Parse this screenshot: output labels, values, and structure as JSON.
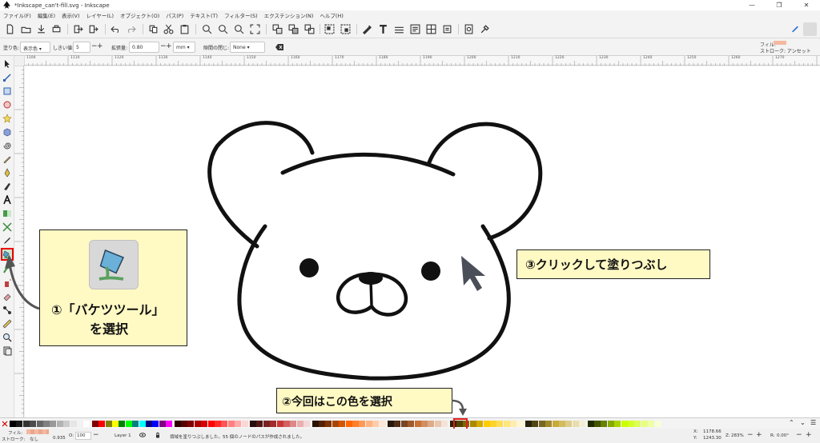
{
  "window": {
    "title": "*Inkscape_can't-fill.svg - Inkscape"
  },
  "menus": [
    "ファイル(F)",
    "編集(E)",
    "表示(V)",
    "レイヤー(L)",
    "オブジェクト(O)",
    "パス(P)",
    "テキスト(T)",
    "フィルター(S)",
    "エクステンション(N)",
    "ヘルプ(H)"
  ],
  "tool_controls": {
    "fill_by_label": "塗り色:",
    "fill_by_value": "表示色",
    "threshold_label": "しきい値:",
    "threshold_value": "5",
    "grow_label": "拡張量:",
    "grow_value": "0.80",
    "unit_value": "mm",
    "close_gaps_label": "隙間の閉じ:",
    "close_gaps_value": "None",
    "fill_indicator_label": "フィル:",
    "stroke_indicator_label": "ストローク: アンセット"
  },
  "ruler": {
    "labels": [
      "1100",
      "1110",
      "1120",
      "1130",
      "1140",
      "1150",
      "1160",
      "1170",
      "1180",
      "1190",
      "1200",
      "1210",
      "1220",
      "1230",
      "1240",
      "1250",
      "1260",
      "1270"
    ]
  },
  "annotations": {
    "step1_line1": "①「バケツツール」",
    "step1_line2": "を選択",
    "step2": "②今回はこの色を選択",
    "step3": "③クリックして塗りつぶし"
  },
  "status": {
    "fill_label": "フィル:",
    "stroke_label": "ストローク:",
    "stroke_value": "なし",
    "stroke_width": "0.935",
    "opacity_label": "O:",
    "opacity_value": "100",
    "layer": "Layer 1",
    "message": "領域を塗りつぶしました。55 個のノードのパスが作成されました。",
    "x_label": "X:",
    "x_value": "1178.66",
    "y_label": "Y:",
    "y_value": "1243.30",
    "zoom_label": "Z:",
    "zoom_value": "283%",
    "rotation_label": "R:",
    "rotation_value": "0.00°"
  },
  "colors": {
    "highlight": "#e02020",
    "callout_bg": "#fff9c4"
  }
}
